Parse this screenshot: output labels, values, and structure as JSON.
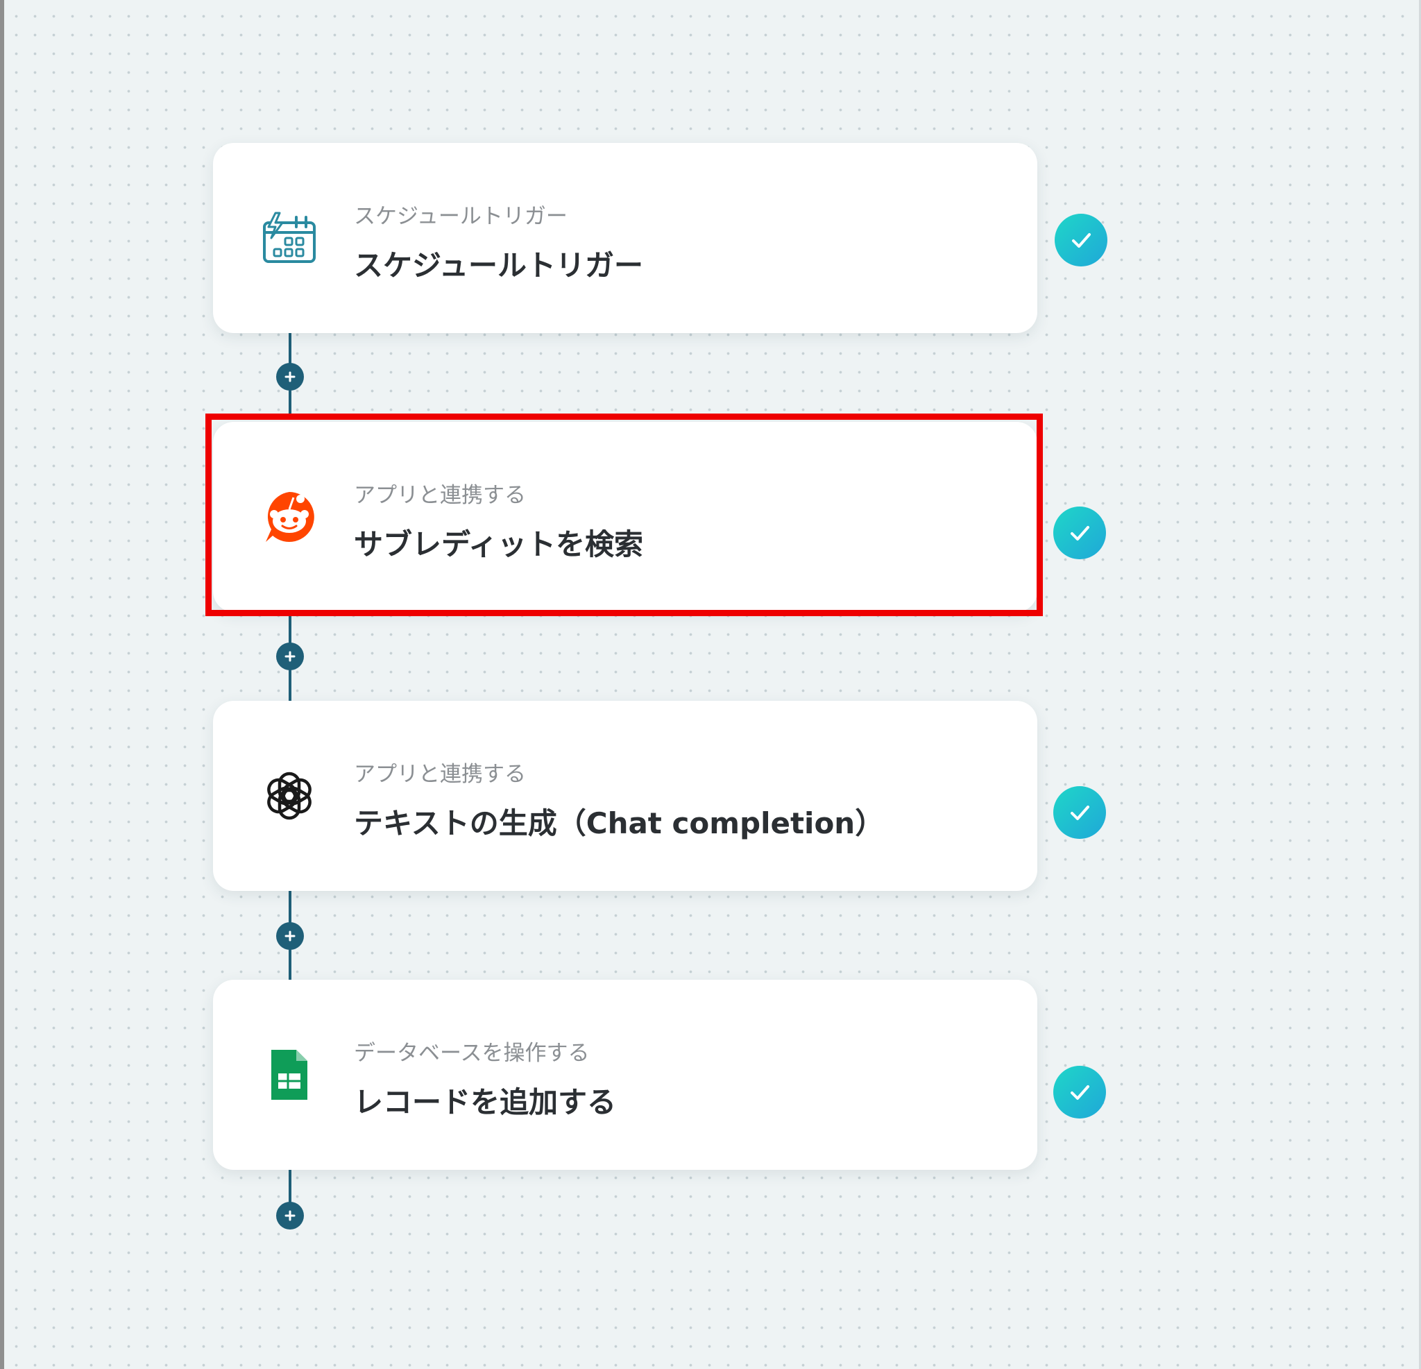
{
  "workflow": {
    "steps": [
      {
        "subtitle": "スケジュールトリガー",
        "title": "スケジュールトリガー",
        "icon": "calendar-trigger-icon",
        "status": "completed"
      },
      {
        "subtitle": "アプリと連携する",
        "title": "サブレディットを検索",
        "icon": "reddit-icon",
        "status": "completed",
        "highlighted": true
      },
      {
        "subtitle": "アプリと連携する",
        "title": "テキストの生成（Chat completion）",
        "icon": "openai-icon",
        "status": "completed"
      },
      {
        "subtitle": "データベースを操作する",
        "title": "レコードを追加する",
        "icon": "google-sheets-icon",
        "status": "completed"
      }
    ]
  },
  "colors": {
    "canvas_background": "#eef3f4",
    "connector": "#1f5f78",
    "check_gradient_start": "#1fd6c8",
    "check_gradient_end": "#1fa8d8",
    "highlight": "#ee0000",
    "reddit": "#ff4500",
    "sheets": "#0f9d58",
    "calendar_icon": "#2a8aa0"
  }
}
